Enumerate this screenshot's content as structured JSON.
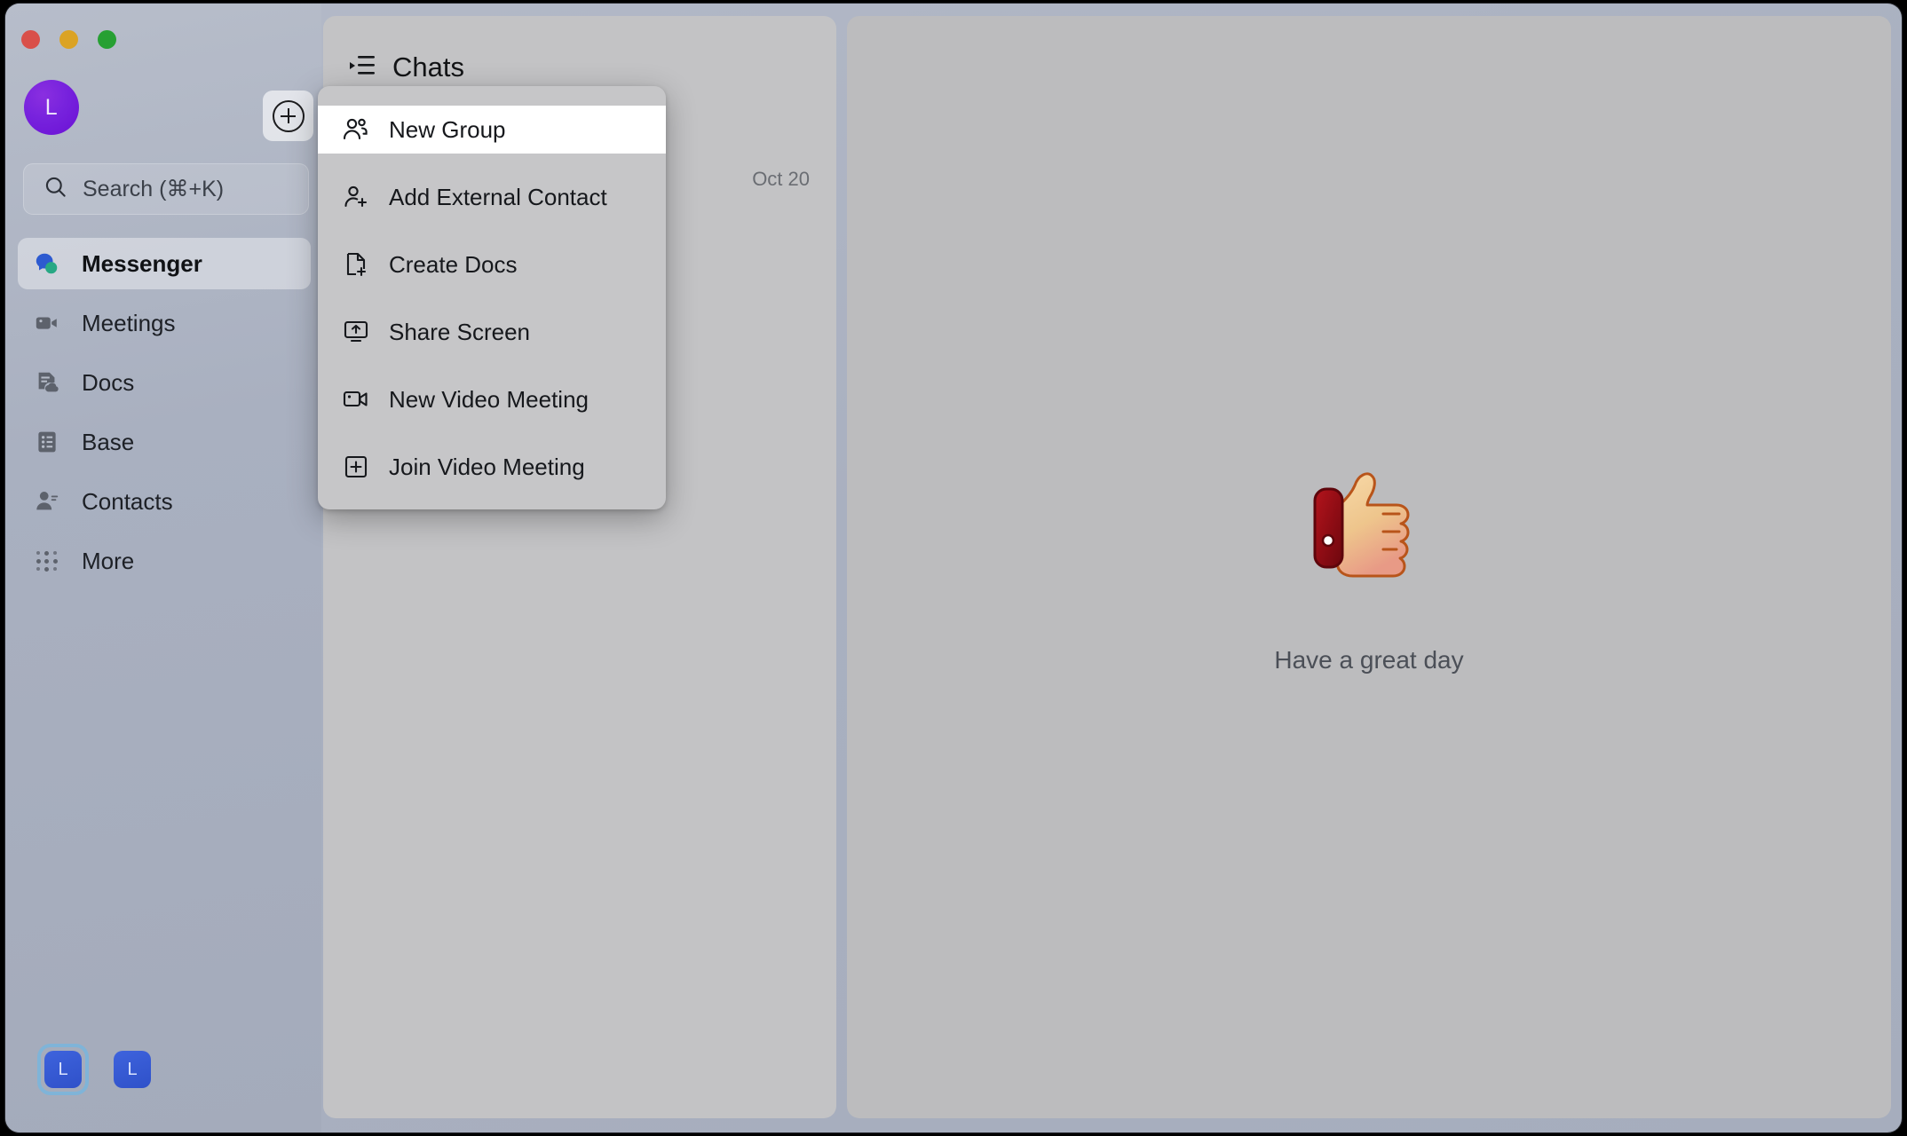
{
  "window": {
    "traffic_lights": [
      {
        "name": "close",
        "color": "#d9504a"
      },
      {
        "name": "minimize",
        "color": "#dba325"
      },
      {
        "name": "maximize",
        "color": "#27a033"
      }
    ]
  },
  "sidebar": {
    "avatar_initial": "L",
    "new_button_label": "+",
    "search": {
      "placeholder": "Search (⌘+K)"
    },
    "items": [
      {
        "label": "Messenger",
        "icon": "messenger-icon",
        "active": true
      },
      {
        "label": "Meetings",
        "icon": "video-camera-icon",
        "active": false
      },
      {
        "label": "Docs",
        "icon": "docs-cloud-icon",
        "active": false
      },
      {
        "label": "Base",
        "icon": "base-grid-icon",
        "active": false
      },
      {
        "label": "Contacts",
        "icon": "contacts-person-icon",
        "active": false
      },
      {
        "label": "More",
        "icon": "more-dots-icon",
        "active": false
      }
    ],
    "dock": [
      {
        "label": "L",
        "selected": true
      },
      {
        "label": "L",
        "selected": false
      }
    ]
  },
  "chat_panel": {
    "title": "Chats",
    "title_icon": "chat-list-icon",
    "rows": [
      {
        "date": "Oct 20"
      }
    ]
  },
  "dropdown_menu": {
    "items": [
      {
        "label": "New Group",
        "icon": "group-people-icon",
        "highlighted": true
      },
      {
        "label": "Add External Contact",
        "icon": "person-add-icon",
        "highlighted": false
      },
      {
        "label": "Create Docs",
        "icon": "document-plus-icon",
        "highlighted": false
      },
      {
        "label": "Share Screen",
        "icon": "share-screen-icon",
        "highlighted": false
      },
      {
        "label": "New Video Meeting",
        "icon": "video-camera-icon",
        "highlighted": false
      },
      {
        "label": "Join Video Meeting",
        "icon": "square-plus-icon",
        "highlighted": false
      }
    ]
  },
  "main_panel": {
    "emoji": "thumbs-up-emoji",
    "greeting": "Have a great day"
  },
  "colors": {
    "sidebar_bg": "#a9b0c0",
    "panel_bg": "#c3c3c5",
    "main_bg": "#bcbcbe",
    "dropdown_bg": "#c6c6c8",
    "avatar_purple": "#7722dd",
    "dock_blue": "#3e63dd",
    "messenger_blue": "#2d5ad0",
    "messenger_green": "#27a884",
    "highlight_white": "#ffffff"
  }
}
